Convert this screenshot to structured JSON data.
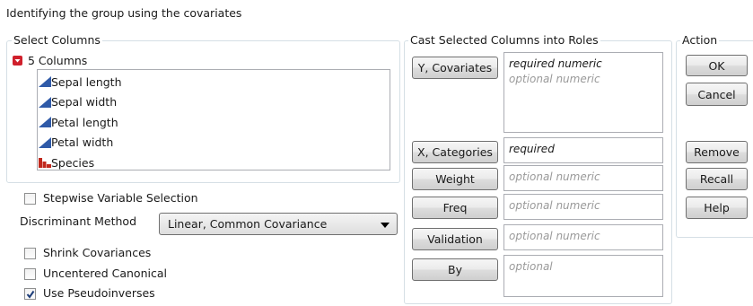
{
  "dialog_title": "Identifying the group using the covariates",
  "select_columns": {
    "title": "Select Columns",
    "count_label": "5 Columns",
    "columns": [
      {
        "label": "Sepal length",
        "icon": "continuous-icon"
      },
      {
        "label": "Sepal width",
        "icon": "continuous-icon"
      },
      {
        "label": "Petal length",
        "icon": "continuous-icon"
      },
      {
        "label": "Petal width",
        "icon": "continuous-icon"
      },
      {
        "label": "Species",
        "icon": "nominal-icon"
      }
    ]
  },
  "options": {
    "stepwise": {
      "label": "Stepwise Variable Selection",
      "checked": false
    },
    "discriminant_method_label": "Discriminant Method",
    "discriminant_method_value": "Linear, Common Covariance",
    "shrink": {
      "label": "Shrink Covariances",
      "checked": false
    },
    "uncentered": {
      "label": "Uncentered Canonical",
      "checked": false
    },
    "pseudoinverses": {
      "label": "Use Pseudoinverses",
      "checked": true
    }
  },
  "cast": {
    "title": "Cast Selected Columns into Roles",
    "roles": {
      "y": {
        "button": "Y, Covariates",
        "required": "required numeric",
        "optional": "optional numeric"
      },
      "x": {
        "button": "X, Categories",
        "required": "required"
      },
      "weight": {
        "button": "Weight",
        "optional": "optional numeric"
      },
      "freq": {
        "button": "Freq",
        "optional": "optional numeric"
      },
      "validation": {
        "button": "Validation",
        "optional": "optional numeric"
      },
      "by": {
        "button": "By",
        "optional": "optional"
      }
    }
  },
  "action": {
    "title": "Action",
    "ok": "OK",
    "cancel": "Cancel",
    "remove": "Remove",
    "recall": "Recall",
    "help": "Help"
  },
  "colors": {
    "continuous_icon": "#2f5aa8",
    "nominal_icon": "#c0281c",
    "disclosure_icon": "#d0202c",
    "group_border": "#d5dfe5"
  }
}
